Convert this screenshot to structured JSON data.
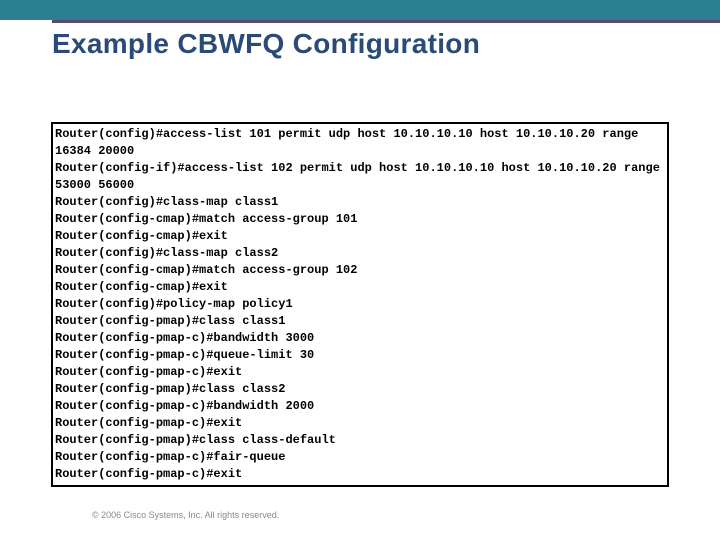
{
  "title": "Example CBWFQ Configuration",
  "config_lines": [
    "Router(config)#access-list 101 permit udp host 10.10.10.10 host 10.10.10.20 range 16384 20000",
    "Router(config-if)#access-list 102 permit udp host 10.10.10.10 host 10.10.10.20 range 53000 56000",
    "Router(config)#class-map class1",
    "Router(config-cmap)#match access-group 101",
    "Router(config-cmap)#exit",
    "Router(config)#class-map class2",
    "Router(config-cmap)#match access-group 102",
    "Router(config-cmap)#exit",
    "Router(config)#policy-map policy1",
    "Router(config-pmap)#class class1",
    "Router(config-pmap-c)#bandwidth 3000",
    "Router(config-pmap-c)#queue-limit 30",
    "Router(config-pmap-c)#exit",
    "Router(config-pmap)#class class2",
    "Router(config-pmap-c)#bandwidth 2000",
    "Router(config-pmap-c)#exit",
    "Router(config-pmap)#class class-default",
    "Router(config-pmap-c)#fair-queue",
    "Router(config-pmap-c)#exit"
  ],
  "footer": "© 2006 Cisco Systems, Inc. All rights reserved."
}
